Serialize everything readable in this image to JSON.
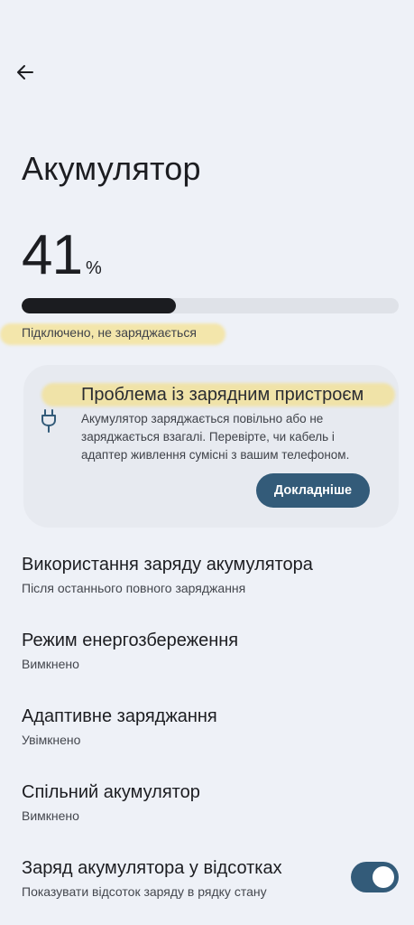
{
  "header": {
    "back_icon": "arrow-left-icon",
    "title": "Акумулятор"
  },
  "battery": {
    "level": "41",
    "unit": "%",
    "fill_fraction": 0.41,
    "status": "Підключено, не заряджається"
  },
  "alert_card": {
    "icon": "power-plug-icon",
    "title": "Проблема із зарядним пристроєм",
    "description": "Акумулятор заряджається повільно або не заряджається взагалі. Перевірте, чи кабель і адаптер живлення сумісні з вашим телефоном.",
    "button_label": "Докладніше"
  },
  "settings": [
    {
      "title": "Використання заряду акумулятора",
      "subtitle": "Після останнього повного заряджання"
    },
    {
      "title": "Режим енергозбереження",
      "subtitle": "Вимкнено"
    },
    {
      "title": "Адаптивне заряджання",
      "subtitle": "Увімкнено"
    },
    {
      "title": "Спільний акумулятор",
      "subtitle": "Вимкнено"
    },
    {
      "title": "Заряд акумулятора у відсотках",
      "subtitle": "Показувати відсоток заряду в рядку стану",
      "toggle_on": true
    }
  ],
  "colors": {
    "background": "#eef1f7",
    "accent": "#335b79",
    "progress_fill": "#1b1c20",
    "highlight": "#f8dc6e"
  }
}
